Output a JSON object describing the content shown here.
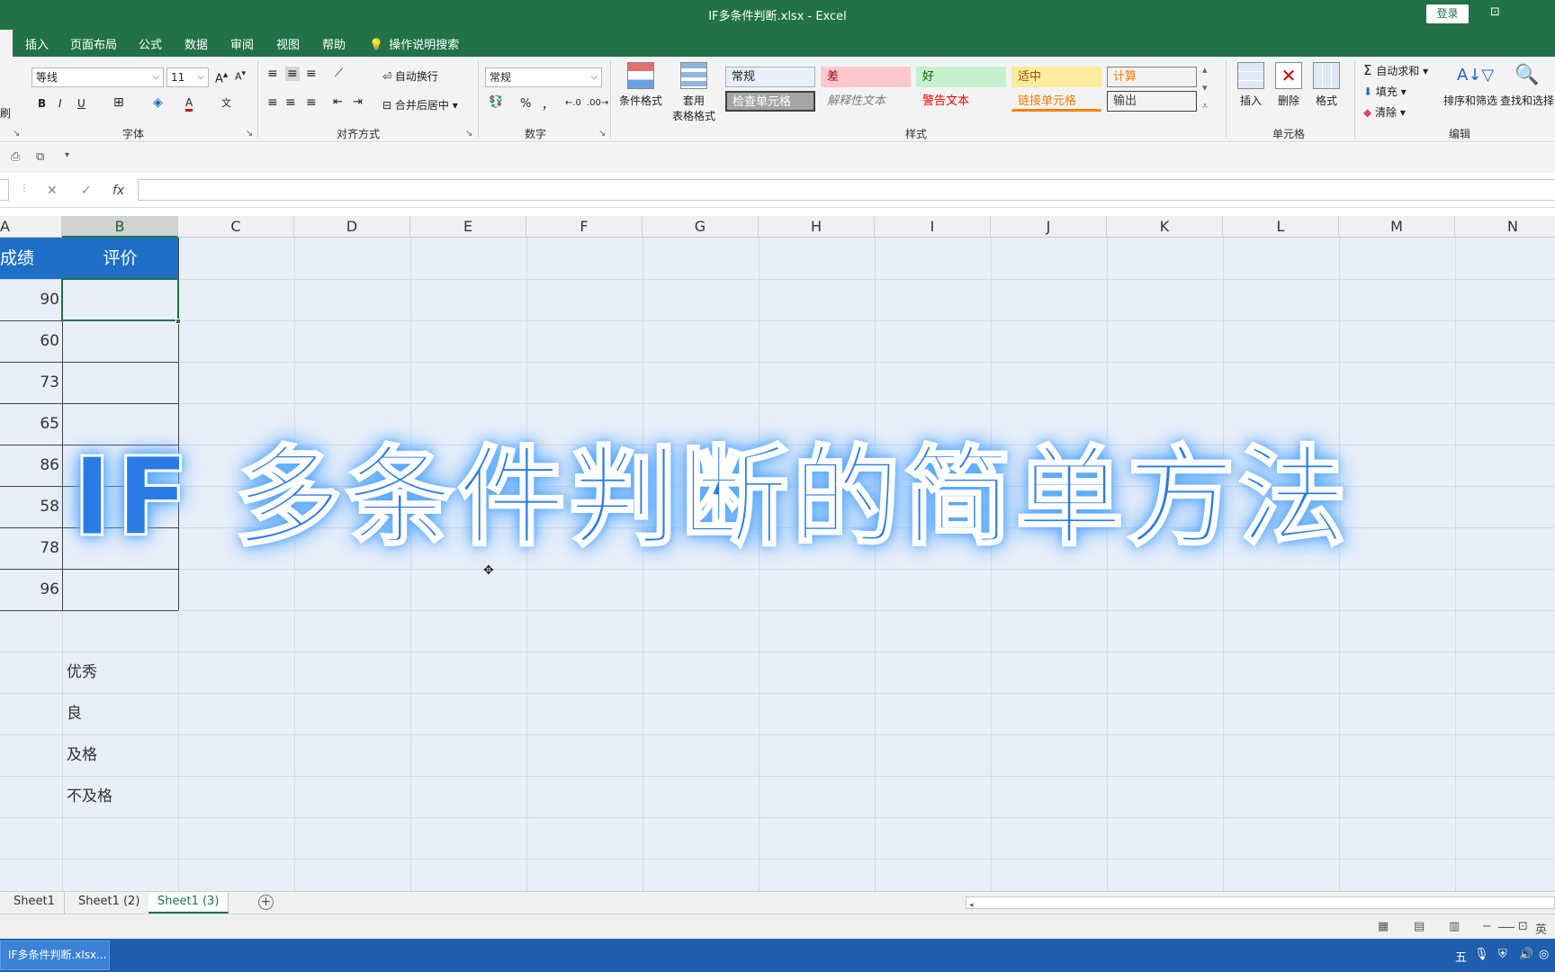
{
  "titlebar": {
    "title": "IF多条件判断.xlsx  -  Excel",
    "login": "登录",
    "ribbon_options": "⊡"
  },
  "menu": {
    "tabs": [
      "插入",
      "页面布局",
      "公式",
      "数据",
      "审阅",
      "视图",
      "帮助"
    ],
    "tellme": "操作说明搜索"
  },
  "ribbon": {
    "font_name": "等线",
    "font_size": "11",
    "wrap_text": "自动换行",
    "merge_center": "合并后居中",
    "number_format": "常规",
    "percent": "%",
    "comma": "，",
    "cond_format": "条件格式",
    "table_format_1": "套用",
    "table_format_2": "表格格式",
    "styles": {
      "normal": "常规",
      "bad": "差",
      "good": "好",
      "neutral": "适中",
      "calc": "计算",
      "check": "检查单元格",
      "explanatory": "解释性文本",
      "warning": "警告文本",
      "linked": "链接单元格",
      "output": "输出"
    },
    "insert": "插入",
    "delete": "删除",
    "format": "格式",
    "autosum": "自动求和",
    "fill": "填充",
    "clear": "清除",
    "sort_filter": "排序和筛选",
    "find_select": "查找和选择",
    "group_labels": {
      "font": "字体",
      "align": "对齐方式",
      "number": "数字",
      "styles": "样式",
      "cells": "单元格",
      "edit": "编辑"
    },
    "left_edge": "刷",
    "bold": "B",
    "italic": "I",
    "underline": "U",
    "font_color": "A"
  },
  "formula_bar": {
    "fx": "fx",
    "cancel": "✕",
    "enter": "✓"
  },
  "grid": {
    "columns": [
      "A",
      "B",
      "C",
      "D",
      "E",
      "F",
      "G",
      "H",
      "I",
      "J",
      "K",
      "L",
      "M",
      "N"
    ],
    "header_a": "成绩",
    "header_b": "评价",
    "scores": [
      "90",
      "60",
      "73",
      "65",
      "86",
      "58",
      "78",
      "96"
    ],
    "levels": [
      "优秀",
      "良",
      "及格",
      "不及格"
    ]
  },
  "overlay_title": "IF 多条件判断的简单方法",
  "sheets": [
    "Sheet1",
    "Sheet1 (2)",
    "Sheet1 (3)"
  ],
  "active_sheet": "Sheet1 (3)",
  "status": {
    "zoom_minus": "−",
    "ime": "英"
  },
  "taskbar": {
    "item": "IF多条件判断.xlsx...",
    "tray_ime": "五"
  }
}
